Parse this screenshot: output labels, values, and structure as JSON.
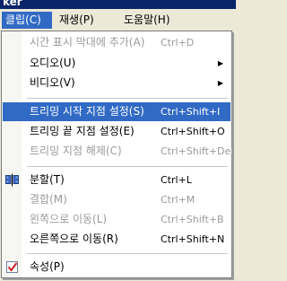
{
  "titlebar": {
    "fragment": "ker"
  },
  "menubar": {
    "items": [
      {
        "label": "클립(C)"
      },
      {
        "label": "재생(P)"
      },
      {
        "label": "도움말(H)"
      }
    ]
  },
  "menu": {
    "items": [
      {
        "label": "시간 표시 막대에 추가(A)",
        "shortcut": "Ctrl+D"
      },
      {
        "label": "오디오(U)"
      },
      {
        "label": "비디오(V)"
      },
      {
        "label": "트리밍 시작 지점 설정(S)",
        "shortcut": "Ctrl+Shift+I"
      },
      {
        "label": "트리밍 끝 지점 설정(E)",
        "shortcut": "Ctrl+Shift+O"
      },
      {
        "label": "트리밍 지점 해제(C)",
        "shortcut": "Ctrl+Shift+Del"
      },
      {
        "label": "분할(T)",
        "shortcut": "Ctrl+L",
        "icon": "split-clip-icon"
      },
      {
        "label": "결합(M)",
        "shortcut": "Ctrl+M"
      },
      {
        "label": "왼쪽으로 이동(L)",
        "shortcut": "Ctrl+Shift+B"
      },
      {
        "label": "오른쪽으로 이동(R)",
        "shortcut": "Ctrl+Shift+N"
      },
      {
        "label": "속성(P)",
        "icon": "properties-check-icon"
      }
    ]
  },
  "colors": {
    "highlight": "#316ac5",
    "disabled_text": "#9a9a9a",
    "menu_background": "#ffffff",
    "menubar_background": "#ece9d8"
  }
}
